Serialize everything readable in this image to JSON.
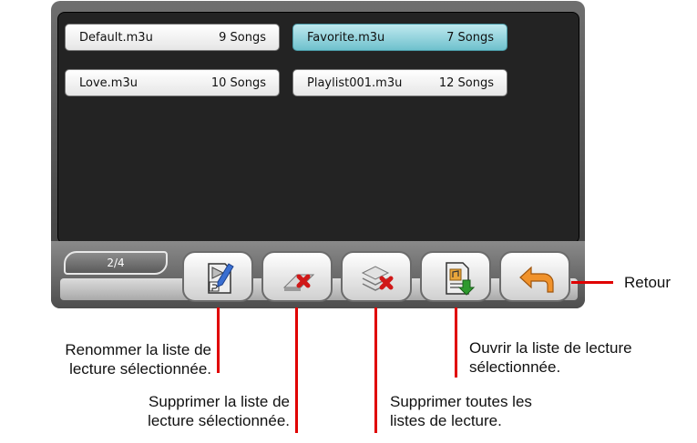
{
  "playlists": [
    {
      "name": "Default.m3u",
      "count": "9 Songs",
      "selected": false
    },
    {
      "name": "Favorite.m3u",
      "count": "7 Songs",
      "selected": true
    },
    {
      "name": "Love.m3u",
      "count": "10 Songs",
      "selected": false
    },
    {
      "name": "Playlist001.m3u",
      "count": "12 Songs",
      "selected": false
    }
  ],
  "toolbar": {
    "page_indicator": "2/4",
    "buttons": [
      {
        "icon": "rename-playlist-icon"
      },
      {
        "icon": "delete-playlist-icon"
      },
      {
        "icon": "delete-all-playlists-icon"
      },
      {
        "icon": "open-playlist-icon"
      },
      {
        "icon": "back-arrow-icon"
      }
    ]
  },
  "callouts": {
    "retour": "Retour",
    "rename_line1": "Renommer la liste de",
    "rename_line2": "lecture sélectionnée.",
    "delete_line1": "Supprimer la liste de",
    "delete_line2": "lecture sélectionnée.",
    "delete_all_line1": "Supprimer toutes les",
    "delete_all_line2": "listes de lecture.",
    "open_line1": "Ouvrir la liste de lecture",
    "open_line2": "sélectionnée."
  },
  "colors": {
    "selected": "#6fc1cd",
    "callout_line": "#e00000",
    "list_bg": "#232323"
  }
}
